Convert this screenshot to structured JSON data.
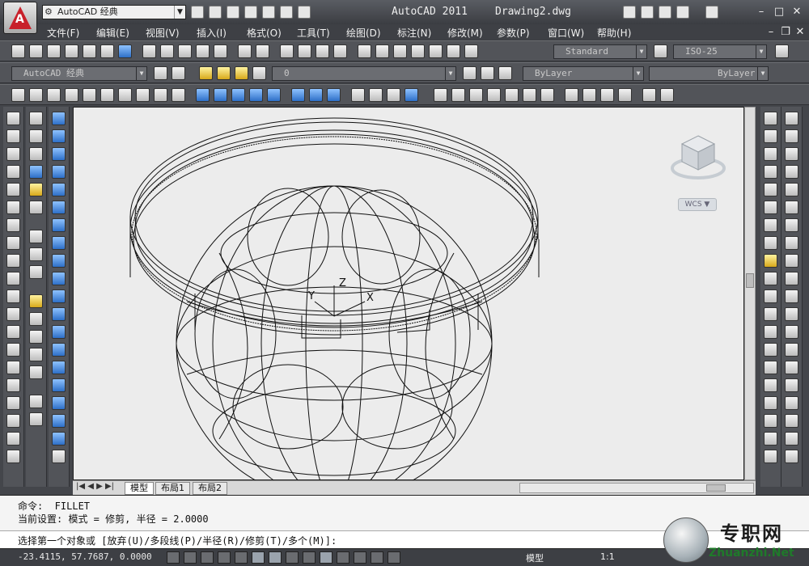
{
  "titlebar": {
    "workspace": "AutoCAD 经典",
    "app_title": "AutoCAD 2011",
    "doc_title": "Drawing2.dwg"
  },
  "menu": [
    "文件(F)",
    "编辑(E)",
    "视图(V)",
    "插入(I)",
    "格式(O)",
    "工具(T)",
    "绘图(D)",
    "标注(N)",
    "修改(M)",
    "参数(P)",
    "窗口(W)",
    "帮助(H)"
  ],
  "toolbars": {
    "text_style": "Standard",
    "dim_style": "ISO-25",
    "workspace_combo": "AutoCAD 经典",
    "layer": "0",
    "color": "ByLayer",
    "linetype": "ByLayer"
  },
  "viewcube": {
    "wcs_label": "WCS"
  },
  "ucs": {
    "z_label": "Z",
    "y_label": "Y",
    "x_label": "X"
  },
  "layout_tabs": [
    "模型",
    "布局1",
    "布局2"
  ],
  "command": {
    "line1": "命令:  FILLET",
    "line2": "当前设置: 模式 = 修剪, 半径 = 2.0000",
    "prompt": "选择第一个对象或 [放弃(U)/多段线(P)/半径(R)/修剪(T)/多个(M)]:"
  },
  "status": {
    "coordinates": "-23.4115, 57.7687, 0.0000",
    "model": "模型",
    "scale": "1:1"
  },
  "watermark": {
    "cn": "专职网",
    "en": "Zhuanzhi.Net"
  }
}
